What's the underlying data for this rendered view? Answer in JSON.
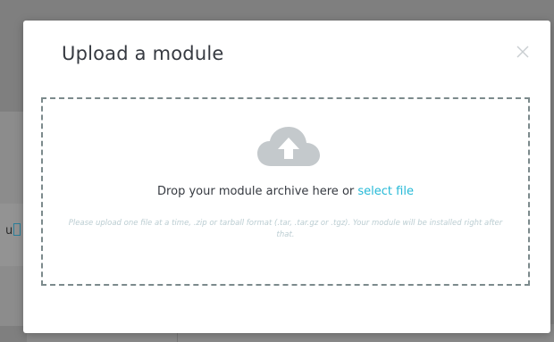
{
  "modal": {
    "title": "Upload a module",
    "close_label": "×"
  },
  "dropzone": {
    "drop_text": "Drop your module archive here or",
    "select_file_link": "select file",
    "help_text": "Please upload one file at a time, .zip or tarball format (.tar, .tar.gz or .tgz). Your module will be installed right after that."
  },
  "background": {
    "partial_text": "u"
  },
  "colors": {
    "link": "#25b9d7",
    "title": "#363a41",
    "help": "#bbcdd2",
    "cloud": "#c4c9cc",
    "overlay": "#7f7f7f"
  },
  "icons": {
    "upload": "cloud-upload-icon",
    "close": "close-icon"
  }
}
